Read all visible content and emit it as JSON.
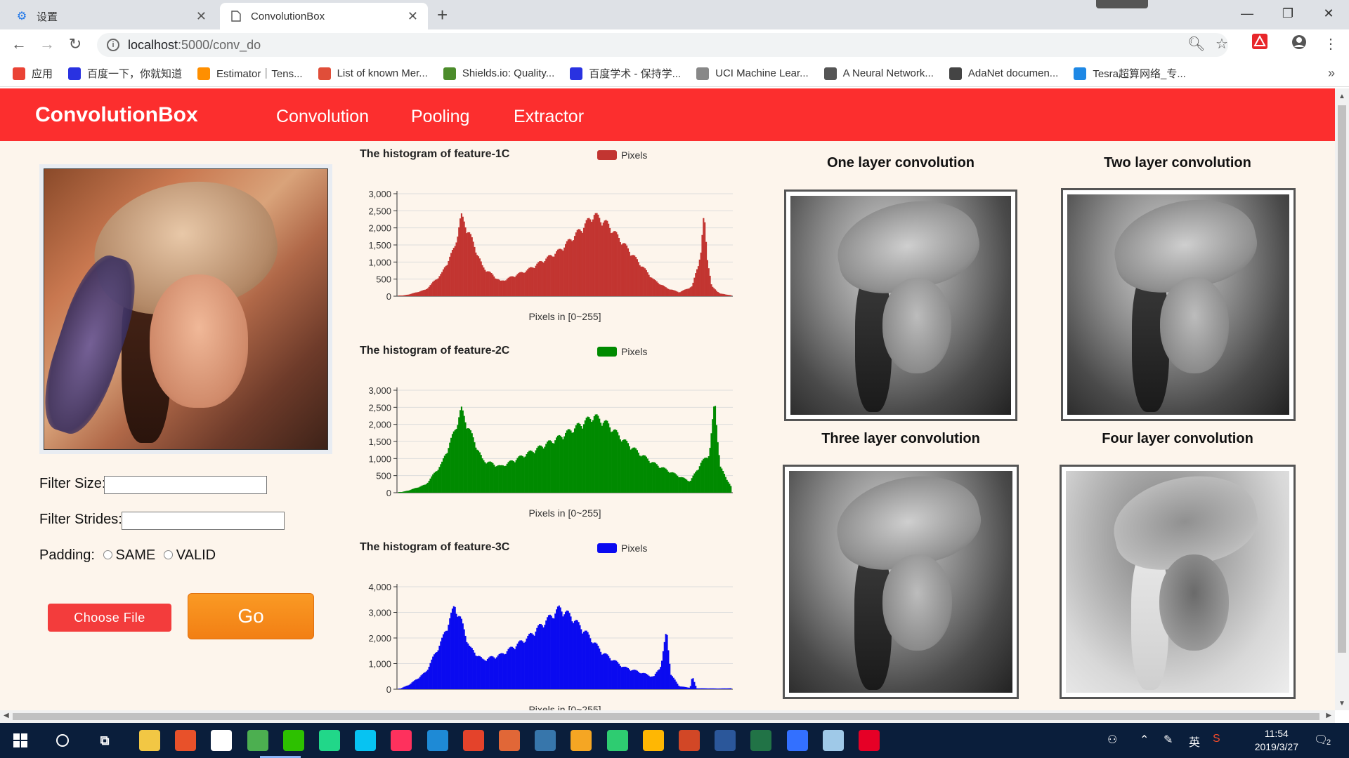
{
  "tabs": [
    {
      "title": "设置",
      "icon": "gear-icon"
    },
    {
      "title": "ConvolutionBox",
      "icon": "page-icon"
    }
  ],
  "address": {
    "host": "localhost",
    "path": ":5000/conv_do"
  },
  "bookmarks": [
    {
      "label": "应用",
      "icon": "apps-icon",
      "color": "#ea4335"
    },
    {
      "label": "百度一下，你就知道",
      "icon": "baidu-icon",
      "color": "#2932e1"
    },
    {
      "label": "Estimator｜Tens...",
      "icon": "tensorflow-icon",
      "color": "#ff8f00"
    },
    {
      "label": "List of known Mer...",
      "icon": "git-icon",
      "color": "#e04e39"
    },
    {
      "label": "Shields.io: Quality...",
      "icon": "shields-icon",
      "color": "#4c8c2b"
    },
    {
      "label": "百度学术 - 保持学...",
      "icon": "baidu-icon",
      "color": "#2932e1"
    },
    {
      "label": "UCI Machine Lear...",
      "icon": "page-icon",
      "color": "#888888"
    },
    {
      "label": "A Neural Network...",
      "icon": "playground-icon",
      "color": "#555555"
    },
    {
      "label": "AdaNet documen...",
      "icon": "docs-icon",
      "color": "#444444"
    },
    {
      "label": "Tesra超算网络_专...",
      "icon": "tesra-icon",
      "color": "#1e88e5"
    }
  ],
  "navbar": {
    "brand": "ConvolutionBox",
    "links": [
      "Convolution",
      "Pooling",
      "Extractor"
    ],
    "color": "#fc2e2e"
  },
  "form": {
    "filter_size_label": "Filter Size:",
    "filter_strides_label": "Filter Strides:",
    "padding_label": "Padding:",
    "padding_options": [
      "SAME",
      "VALID"
    ],
    "choose_file": "Choose File",
    "go": "Go"
  },
  "histograms": [
    {
      "title": "The histogram of feature-1C",
      "legend": "Pixels",
      "color": "#c23531",
      "xlabel": "Pixels in [0~255]",
      "yticks": [
        "3,000",
        "2,500",
        "2,000",
        "1,500",
        "1,000",
        "500",
        "0"
      ],
      "ymax": 3000,
      "peaks": [
        [
          0,
          0
        ],
        [
          10,
          60
        ],
        [
          25,
          200
        ],
        [
          40,
          700
        ],
        [
          52,
          1500
        ],
        [
          58,
          2450
        ],
        [
          66,
          1900
        ],
        [
          78,
          900
        ],
        [
          95,
          450
        ],
        [
          120,
          800
        ],
        [
          150,
          1400
        ],
        [
          170,
          2050
        ],
        [
          182,
          2500
        ],
        [
          195,
          2200
        ],
        [
          210,
          1600
        ],
        [
          225,
          1000
        ],
        [
          238,
          500
        ],
        [
          250,
          250
        ],
        [
          262,
          120
        ],
        [
          274,
          300
        ],
        [
          282,
          1300
        ],
        [
          285,
          2500
        ],
        [
          288,
          1200
        ],
        [
          292,
          300
        ],
        [
          300,
          80
        ],
        [
          310,
          30
        ]
      ]
    },
    {
      "title": "The histogram of feature-2C",
      "legend": "Pixels",
      "color": "#008a00",
      "xlabel": "Pixels in [0~255]",
      "yticks": [
        "3,000",
        "2,500",
        "2,000",
        "1,500",
        "1,000",
        "500",
        "0"
      ],
      "ymax": 3000,
      "peaks": [
        [
          0,
          0
        ],
        [
          10,
          80
        ],
        [
          25,
          250
        ],
        [
          40,
          900
        ],
        [
          52,
          1900
        ],
        [
          58,
          2550
        ],
        [
          66,
          1900
        ],
        [
          78,
          1000
        ],
        [
          95,
          800
        ],
        [
          120,
          1200
        ],
        [
          150,
          1700
        ],
        [
          170,
          2100
        ],
        [
          182,
          2350
        ],
        [
          195,
          2100
        ],
        [
          210,
          1600
        ],
        [
          225,
          1200
        ],
        [
          238,
          900
        ],
        [
          250,
          700
        ],
        [
          262,
          500
        ],
        [
          272,
          350
        ],
        [
          282,
          900
        ],
        [
          290,
          1200
        ],
        [
          295,
          2800
        ],
        [
          300,
          800
        ],
        [
          310,
          200
        ]
      ]
    },
    {
      "title": "The histogram of feature-3C",
      "legend": "Pixels",
      "color": "#0a0af0",
      "xlabel": "Pixels in [0~255]",
      "yticks": [
        "4,000",
        "3,000",
        "2,000",
        "1,000",
        "0"
      ],
      "ymax": 4000,
      "peaks": [
        [
          0,
          0
        ],
        [
          10,
          200
        ],
        [
          25,
          700
        ],
        [
          40,
          2000
        ],
        [
          52,
          3400
        ],
        [
          58,
          2800
        ],
        [
          66,
          1700
        ],
        [
          78,
          1200
        ],
        [
          95,
          1400
        ],
        [
          120,
          2100
        ],
        [
          140,
          2900
        ],
        [
          150,
          3300
        ],
        [
          160,
          3000
        ],
        [
          175,
          2300
        ],
        [
          190,
          1500
        ],
        [
          210,
          900
        ],
        [
          225,
          700
        ],
        [
          238,
          500
        ],
        [
          245,
          1000
        ],
        [
          250,
          2400
        ],
        [
          254,
          600
        ],
        [
          262,
          120
        ],
        [
          272,
          60
        ],
        [
          274,
          520
        ],
        [
          278,
          40
        ],
        [
          300,
          30
        ],
        [
          310,
          40
        ]
      ]
    }
  ],
  "outputs": [
    {
      "title": "One layer convolution"
    },
    {
      "title": "Two layer convolution"
    },
    {
      "title": "Three layer convolution"
    },
    {
      "title": "Four layer convolution"
    }
  ],
  "taskbar": {
    "time": "11:54",
    "date": "2019/3/27",
    "ime": "英",
    "notifications": "2"
  }
}
